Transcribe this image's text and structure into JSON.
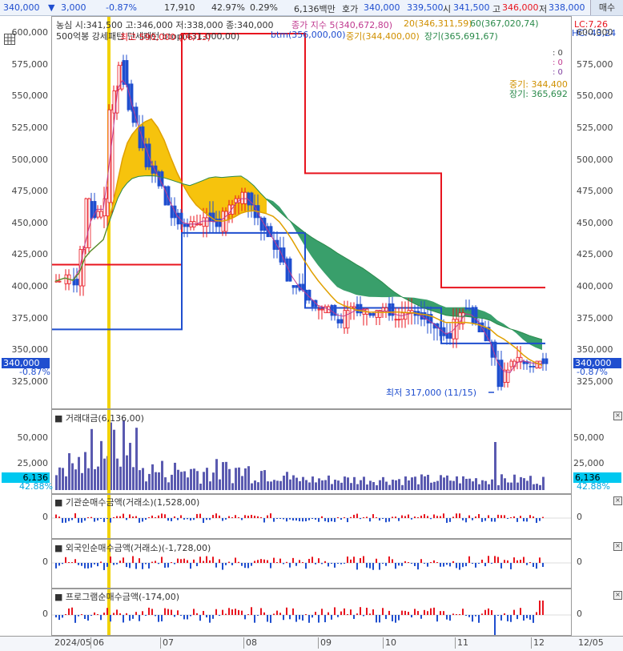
{
  "topbar": {
    "price": "340,000",
    "change": "3,000",
    "change_pct": "-0.87%",
    "volume": "17,910",
    "vol_ratio": "42.97%",
    "turnover_pct": "0.29%",
    "amount": "6,136백만",
    "quote_label": "호가",
    "quote_ask": "340,000",
    "quote_bid": "339,500",
    "open_label": "시",
    "open": "341,500",
    "high_label": "고",
    "high": "346,000",
    "low_label": "저",
    "low": "338,000",
    "buy_button": "매수"
  },
  "main_panel": {
    "legend1": "농심 시:341,500 고:346,000 저:338,000 종:340,000",
    "legend_ma": "종가 지수 5(340,672,80)",
    "legend_ma20": "20(346,311,59)",
    "legend_ma60": "60(367,020,74)",
    "legend2": "500억봉 강세패턴 단세패턴 btop(431,000,00)",
    "legend_btm": "btm(356,000,00)",
    "legend_short": "중기(344,400,00)",
    "legend_long": "장기(365,691,67)",
    "high_label": "최고 590,000 (06/13)",
    "low_label": "최저 317,000 (11/15)",
    "right_info": [
      ": 0",
      ": 0",
      ": 0"
    ],
    "right_short": "중기: 344,400",
    "right_long": "장기: 365,692",
    "lc_label": "LC:7,26",
    "hc_label": "HC:-43,24",
    "current_price_tag": "340,000",
    "current_pct_tag": "-0.87%",
    "y_ticks": [
      "600,000",
      "575,000",
      "550,000",
      "525,000",
      "500,000",
      "475,000",
      "450,000",
      "425,000",
      "400,000",
      "375,000",
      "350,000",
      "325,000"
    ]
  },
  "volume_panel": {
    "title": "거래대금(6,136,00)",
    "y_ticks": [
      "50,000",
      "25,000"
    ],
    "value_tag": "6,136",
    "pct_tag": "42.88%"
  },
  "inst_panel": {
    "title": "기관순매수금액(거래소)(1,528,00)",
    "zero": "0"
  },
  "foreign_panel": {
    "title": "외국인순매수금액(거래소)(-1,728,00)",
    "zero": "0"
  },
  "program_panel": {
    "title": "프로그램순매수금액(-174,00)",
    "zero": "0"
  },
  "x_axis": [
    "2024/05",
    "06",
    "07",
    "08",
    "09",
    "10",
    "11",
    "12",
    "12/05"
  ],
  "colors": {
    "up": "#e8141e",
    "down": "#1f4ecf",
    "short_cloud": "#f5c000",
    "long_cloud": "#2e9a63",
    "highlight": "#f2d200"
  },
  "chart_data": {
    "type": "candlestick",
    "x": [
      "2024/05",
      "06",
      "07",
      "08",
      "09",
      "10",
      "11",
      "12"
    ],
    "close_approx": [
      405000,
      480000,
      455000,
      450000,
      385000,
      375000,
      360000,
      340000
    ],
    "ylim": [
      310000,
      605000
    ],
    "high": 590000,
    "low": 317000,
    "last": {
      "open": 341500,
      "high": 346000,
      "low": 338000,
      "close": 340000
    }
  }
}
